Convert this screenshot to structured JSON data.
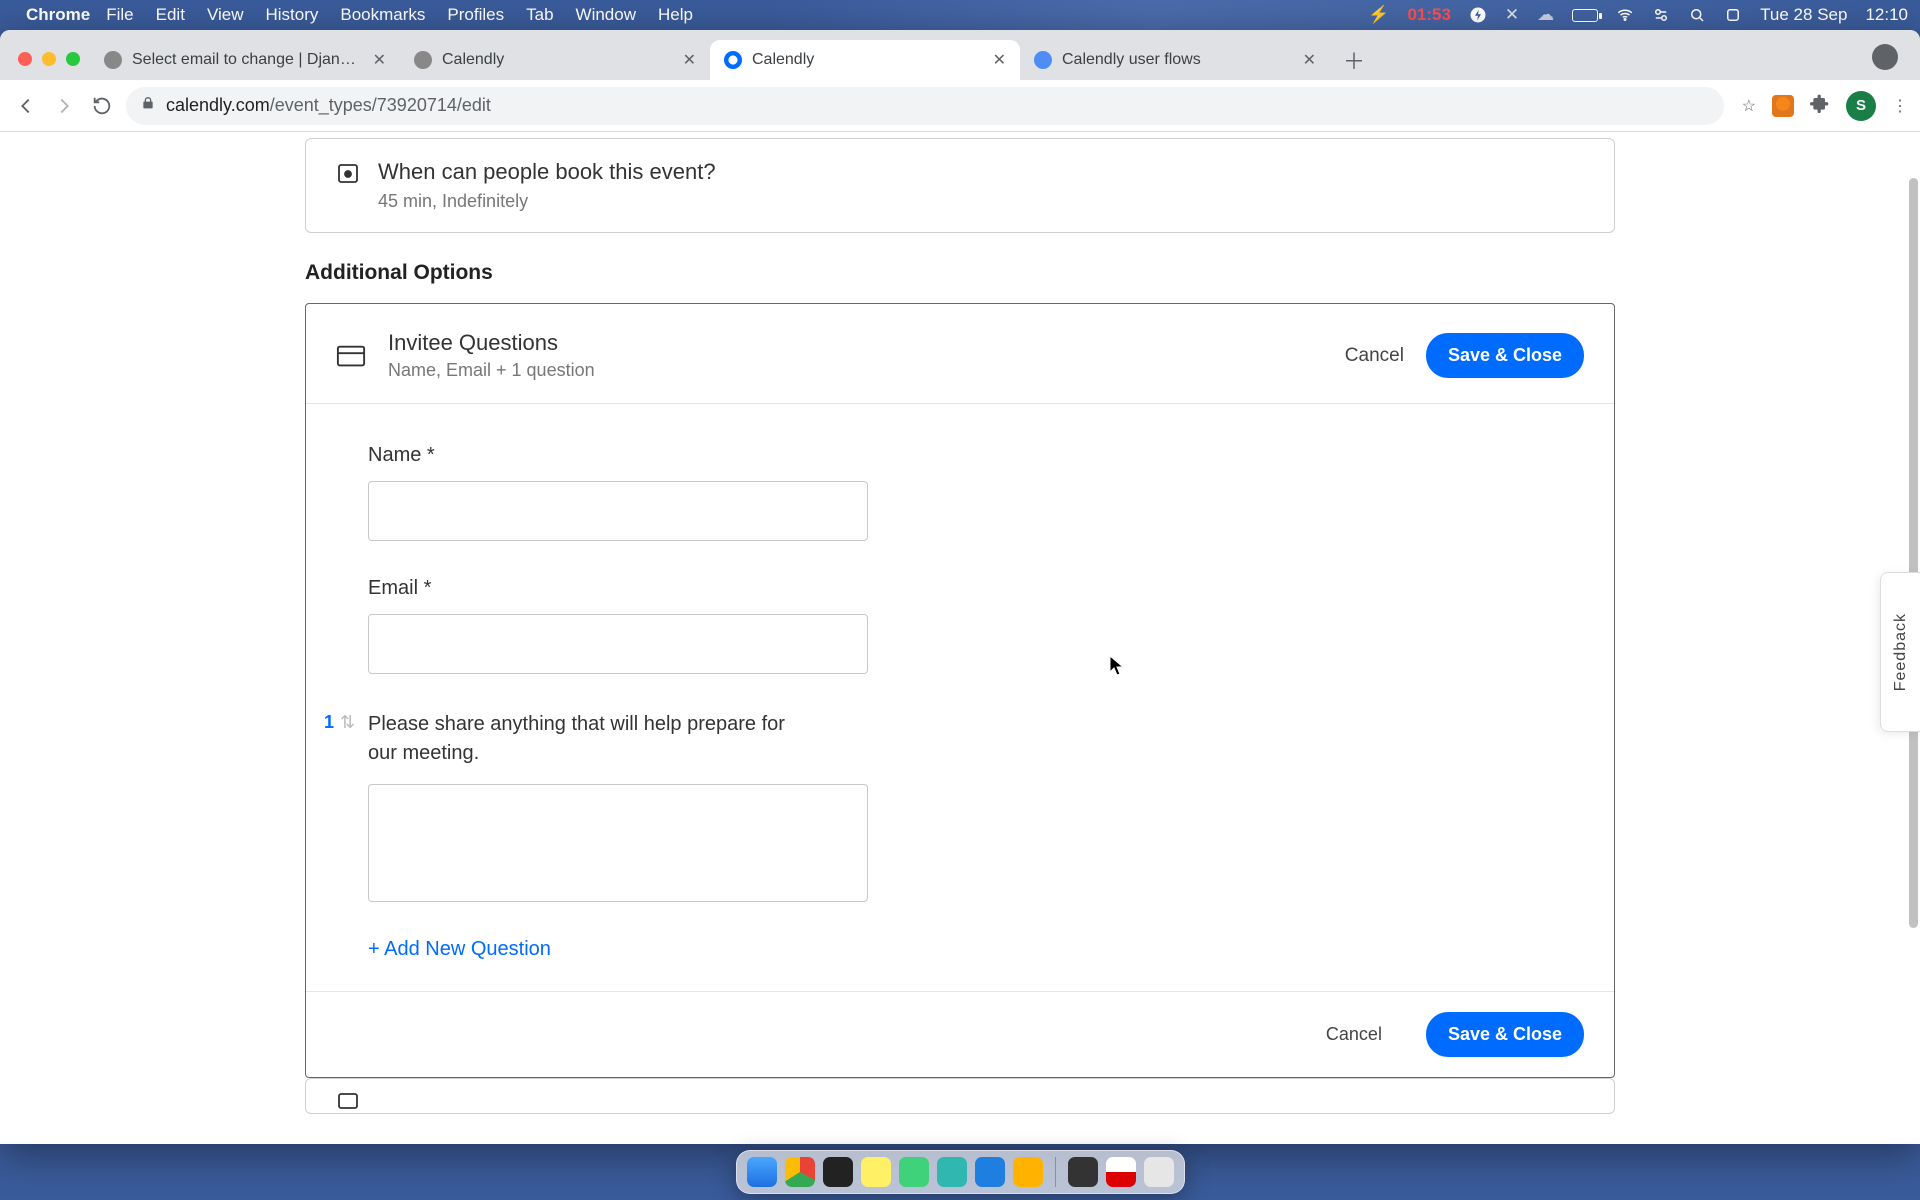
{
  "menubar": {
    "app": "Chrome",
    "items": [
      "File",
      "Edit",
      "View",
      "History",
      "Bookmarks",
      "Profiles",
      "Tab",
      "Window",
      "Help"
    ],
    "batt_time": "01:53",
    "date": "Tue 28 Sep",
    "clock": "12:10"
  },
  "tabs": [
    {
      "title": "Select email to change | Djang…",
      "fav": "generic",
      "active": false
    },
    {
      "title": "Calendly",
      "fav": "generic",
      "active": false
    },
    {
      "title": "Calendly",
      "fav": "calendly",
      "active": true
    },
    {
      "title": "Calendly user flows",
      "fav": "pf",
      "active": false
    }
  ],
  "url": {
    "host": "calendly.com",
    "path": "/event_types/73920714/edit"
  },
  "avatar_letter": "S",
  "when_card": {
    "title": "When can people book this event?",
    "sub": "45 min, Indefinitely"
  },
  "section_heading": "Additional Options",
  "qcard": {
    "title": "Invitee Questions",
    "sub": "Name, Email + 1 question",
    "cancel": "Cancel",
    "save": "Save & Close"
  },
  "fields": {
    "name_label": "Name *",
    "email_label": "Email *",
    "q1_num": "1",
    "q1_text": "Please share anything that will help prepare for our meeting.",
    "add_new": "+ Add New Question"
  },
  "footer": {
    "cancel": "Cancel",
    "save": "Save & Close"
  },
  "feedback": "Feedback"
}
